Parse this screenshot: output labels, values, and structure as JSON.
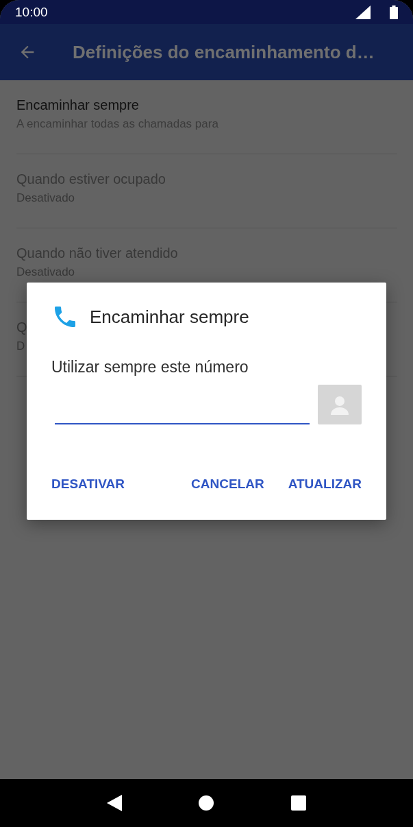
{
  "status_bar": {
    "time": "10:00"
  },
  "app_bar": {
    "title": "Definições do encaminhamento d…"
  },
  "settings": [
    {
      "title": "Encaminhar sempre",
      "summary": "A encaminhar todas as chamadas para",
      "disabled": false
    },
    {
      "title": "Quando estiver ocupado",
      "summary": "Desativado",
      "disabled": true
    },
    {
      "title": "Quando não tiver atendido",
      "summary": "Desativado",
      "disabled": true
    },
    {
      "title": "Q",
      "summary": "D",
      "disabled": true
    }
  ],
  "dialog": {
    "title": "Encaminhar sempre",
    "label": "Utilizar sempre este número",
    "buttons": [
      {
        "label": "DESATIVAR",
        "kind": "left"
      },
      {
        "label": "CANCELAR",
        "kind": "right"
      },
      {
        "label": "ATUALIZAR",
        "kind": "right"
      }
    ]
  }
}
